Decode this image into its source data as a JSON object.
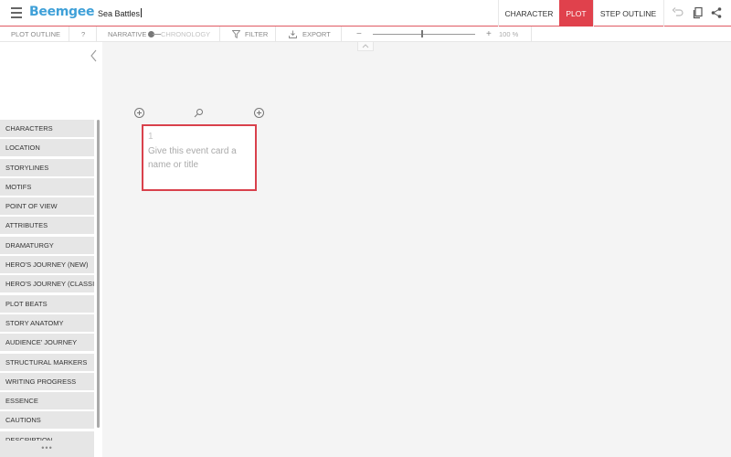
{
  "app": {
    "logo": "Beemgee",
    "document_title": "Sea Battles"
  },
  "view_tabs": [
    {
      "label": "CHARACTER",
      "active": false
    },
    {
      "label": "PLOT",
      "active": true
    },
    {
      "label": "STEP OUTLINE",
      "active": false
    }
  ],
  "top_icons": [
    "undo-icon",
    "copy-icon",
    "share-icon"
  ],
  "toolbar": {
    "plot_outline": "PLOT OUTLINE",
    "help": "?",
    "narrative": "NARRATIVE",
    "chronology": "CHRONOLOGY",
    "filter": "FILTER",
    "export": "EXPORT",
    "zoom_out": "−",
    "zoom_in": "+",
    "zoom_level": "100 %"
  },
  "sidebar": {
    "items": [
      "CHARACTERS",
      "LOCATION",
      "STORYLINES",
      "MOTIFS",
      "POINT OF VIEW",
      "ATTRIBUTES",
      "DRAMATURGY",
      "HERO'S JOURNEY (NEW)",
      "HERO'S JOURNEY (CLASSI...",
      "PLOT BEATS",
      "STORY ANATOMY",
      "AUDIENCE' JOURNEY",
      "STRUCTURAL MARKERS",
      "WRITING PROGRESS",
      "ESSENCE",
      "CAUTIONS",
      "DESCRIPTION"
    ],
    "more": "•••"
  },
  "canvas": {
    "event_card": {
      "number": "1",
      "placeholder": "Give this event card a name or title"
    }
  },
  "colors": {
    "accent": "#e0414c",
    "logo": "#3fa0d8",
    "canvas_bg": "#f4f4f4",
    "sidebar_item_bg": "#e6e6e6"
  }
}
